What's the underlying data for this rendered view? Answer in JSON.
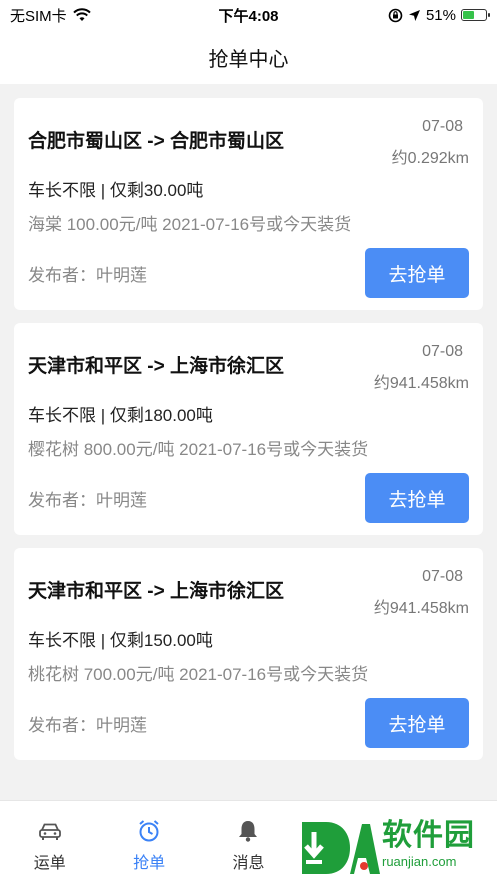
{
  "status_bar": {
    "carrier": "无SIM卡",
    "time": "下午4:08",
    "battery_percent": "51%",
    "battery_level": 0.51
  },
  "nav": {
    "title": "抢单中心"
  },
  "orders": [
    {
      "route": "合肥市蜀山区 -> 合肥市蜀山区",
      "date": "07-08",
      "distance": "约0.292km",
      "capacity": "车长不限 | 仅剩30.00吨",
      "cargo": "海棠 100.00元/吨 2021-07-16号或今天装货",
      "publisher": "发布者：叶明莲",
      "button": "去抢单"
    },
    {
      "route": "天津市和平区 -> 上海市徐汇区",
      "date": "07-08",
      "distance": "约941.458km",
      "capacity": "车长不限 | 仅剩180.00吨",
      "cargo": "樱花树 800.00元/吨 2021-07-16号或今天装货",
      "publisher": "发布者：叶明莲",
      "button": "去抢单"
    },
    {
      "route": "天津市和平区 -> 上海市徐汇区",
      "date": "07-08",
      "distance": "约941.458km",
      "capacity": "车长不限 | 仅剩150.00吨",
      "cargo": "桃花树 700.00元/吨 2021-07-16号或今天装货",
      "publisher": "发布者：叶明莲",
      "button": "去抢单"
    }
  ],
  "tabs": [
    {
      "label": "运单",
      "icon": "car-icon",
      "active": false
    },
    {
      "label": "抢单",
      "icon": "alarm-clock-icon",
      "active": true
    },
    {
      "label": "消息",
      "icon": "bell-icon",
      "active": false
    }
  ],
  "watermark": {
    "title": "软件园",
    "url": "ruanjian.com"
  },
  "colors": {
    "accent": "#4b8df5",
    "tab_active": "#3b82f6",
    "watermark": "#1f9e3a"
  }
}
